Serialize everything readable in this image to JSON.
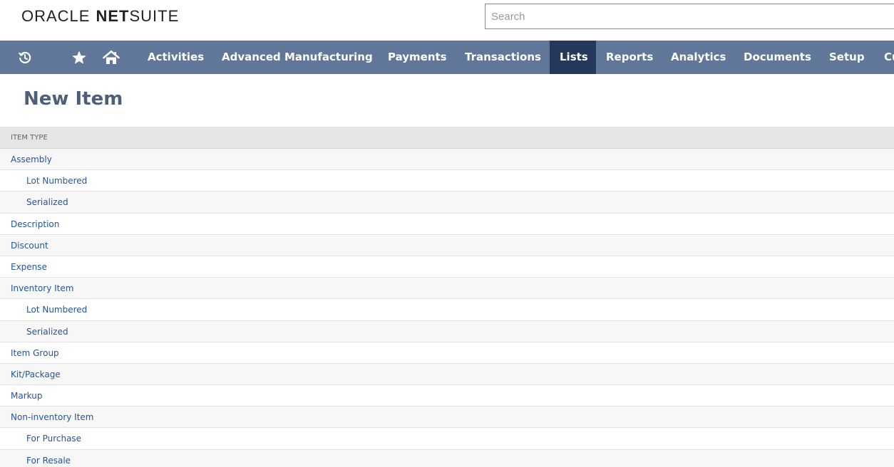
{
  "header": {
    "logo_oracle": "ORACLE",
    "logo_net": "NET",
    "logo_suite": "SUITE",
    "search_placeholder": "Search"
  },
  "nav": {
    "icons": [
      "recent-records-icon",
      "star-icon",
      "home-icon"
    ],
    "items": [
      {
        "label": "Activities"
      },
      {
        "label": "Advanced Manufacturing"
      },
      {
        "label": "Payments"
      },
      {
        "label": "Transactions"
      },
      {
        "label": "Lists",
        "active": true
      },
      {
        "label": "Reports"
      },
      {
        "label": "Analytics"
      },
      {
        "label": "Documents"
      },
      {
        "label": "Setup"
      },
      {
        "label": "Cu"
      }
    ],
    "colors": {
      "bar": "#607799",
      "active": "#24385b",
      "text": "#ffffff"
    }
  },
  "page": {
    "title": "New Item"
  },
  "list": {
    "header": "ITEM TYPE",
    "items": [
      {
        "label": "Assembly",
        "level": 0
      },
      {
        "label": "Lot Numbered",
        "level": 1
      },
      {
        "label": "Serialized",
        "level": 1
      },
      {
        "label": "Description",
        "level": 0
      },
      {
        "label": "Discount",
        "level": 0
      },
      {
        "label": "Expense",
        "level": 0
      },
      {
        "label": "Inventory Item",
        "level": 0
      },
      {
        "label": "Lot Numbered",
        "level": 1
      },
      {
        "label": "Serialized",
        "level": 1
      },
      {
        "label": "Item Group",
        "level": 0
      },
      {
        "label": "Kit/Package",
        "level": 0
      },
      {
        "label": "Markup",
        "level": 0
      },
      {
        "label": "Non-inventory Item",
        "level": 0
      },
      {
        "label": "For Purchase",
        "level": 1
      },
      {
        "label": "For Resale",
        "level": 1
      }
    ],
    "link_color": "#255599"
  }
}
